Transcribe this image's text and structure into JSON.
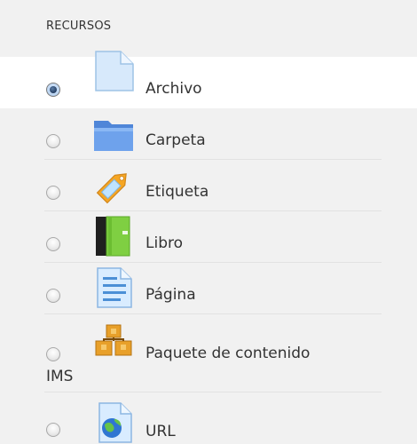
{
  "section": {
    "title": "RECURSOS"
  },
  "resources": [
    {
      "label": "Archivo",
      "icon": "file-icon",
      "selected": true
    },
    {
      "label": "Carpeta",
      "icon": "folder-icon",
      "selected": false
    },
    {
      "label": "Etiqueta",
      "icon": "label-tag-icon",
      "selected": false
    },
    {
      "label": "Libro",
      "icon": "book-icon",
      "selected": false
    },
    {
      "label": "Página",
      "icon": "page-icon",
      "selected": false
    },
    {
      "label_line1": "Paquete de contenido",
      "label_line2": "IMS",
      "icon": "ims-package-icon",
      "selected": false
    },
    {
      "label": "URL",
      "icon": "url-globe-icon",
      "selected": false
    }
  ],
  "colors": {
    "panel_bg": "#f1f1f1",
    "selected_row_bg": "#ffffff",
    "separator": "#e2e2e2",
    "text": "#333333"
  }
}
